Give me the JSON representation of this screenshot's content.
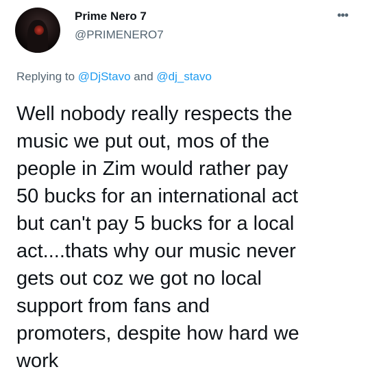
{
  "tweet": {
    "author": {
      "display_name": "Prime Nero 7",
      "handle": "@PRIMENERO7"
    },
    "more_label": "•••",
    "reply": {
      "prefix": "Replying to ",
      "mention_1": "@DjStavo",
      "joiner": " and ",
      "mention_2": "@dj_stavo"
    },
    "text_lines": [
      "Well nobody really respects the",
      "music we put out, mos of the",
      "people in Zim would rather pay",
      "50 bucks for an international act",
      "but can't pay 5 bucks for a local",
      "act....thats why our music never",
      "gets out coz we got no local",
      "support from fans and",
      "promoters, despite how hard we",
      "work"
    ]
  },
  "colors": {
    "text_primary": "#0f1419",
    "text_secondary": "#536471",
    "link": "#1d9bf0",
    "background": "#ffffff"
  }
}
